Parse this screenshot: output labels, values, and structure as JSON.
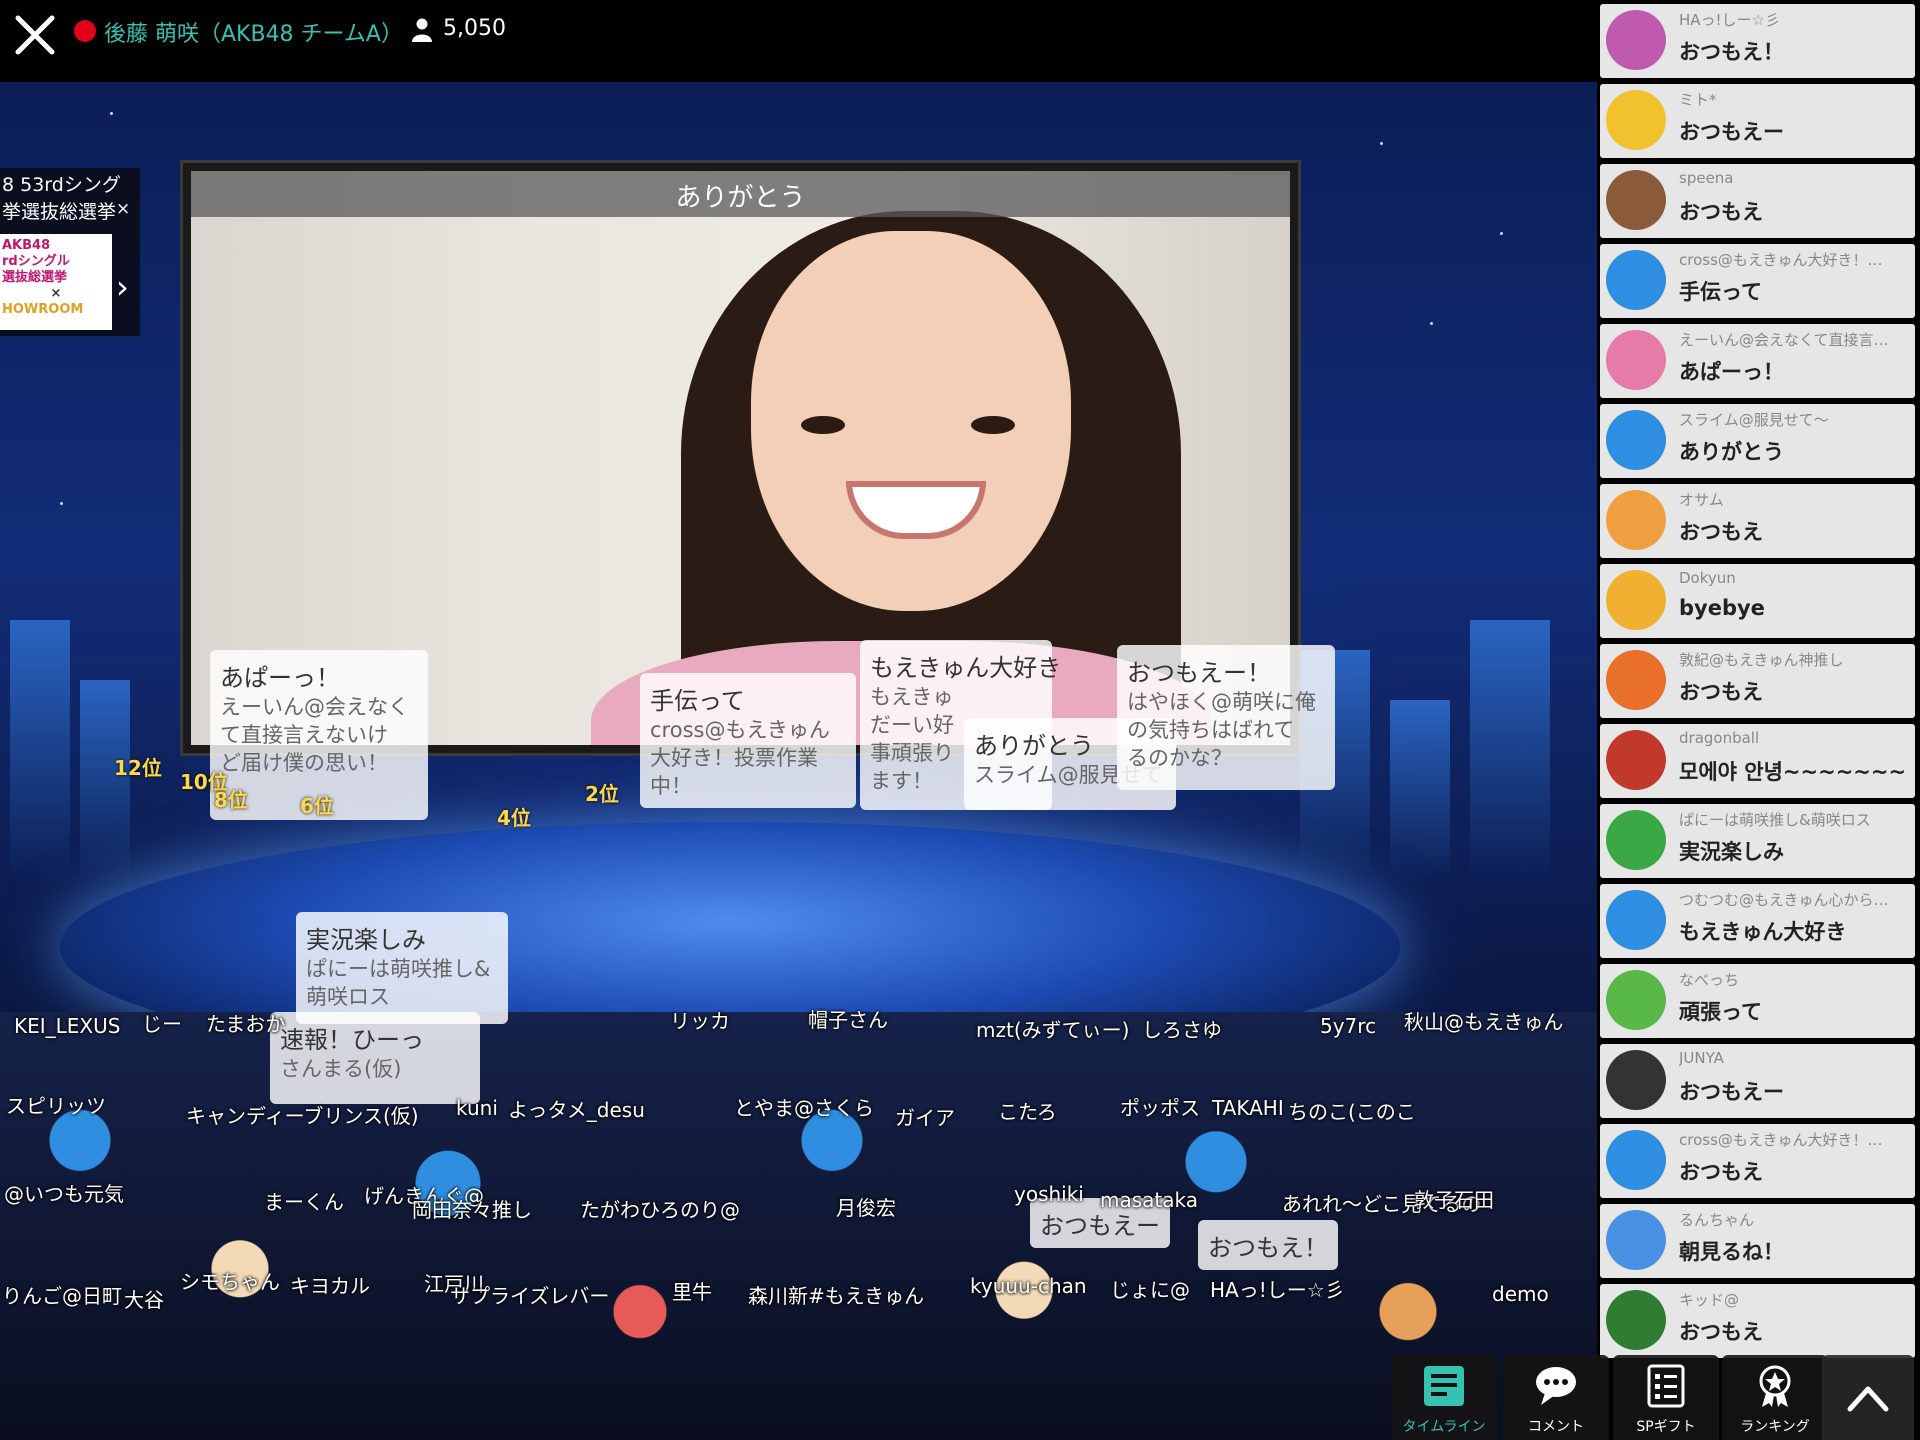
{
  "header": {
    "streamer": "後藤 萌咲（AKB48 チームA）",
    "viewers": "5,050"
  },
  "event": {
    "text_line1": "8 53rdシング",
    "text_line2": "挙選抜総選挙",
    "close": "×",
    "logo_line1": "AKB48",
    "logo_line2": "rdシングル",
    "logo_line3": "選抜総選挙",
    "logo_line4": "×",
    "logo_line5": "HOWROOM",
    "arrow": "›"
  },
  "video": {
    "title": "ありがとう"
  },
  "bubbles": [
    {
      "title": "あぱーっ！",
      "sub": "えーいん@会えなく\nて直接言えないけ\nど届け僕の思い！"
    },
    {
      "title": "手伝って",
      "sub": "cross@もえきゅん\n大好き！投票作業\n中！"
    },
    {
      "title": "もえきゅん大好き",
      "sub": "もえきゅ\nだーい好\n事頑張り\nます！"
    },
    {
      "title": "ありがとう",
      "sub": "スライム@服見せて"
    },
    {
      "title": "おつもえー！",
      "sub": "はやほく@萌咲に俺\nの気持ちはばれて\nるのかな？"
    },
    {
      "title": "実況楽しみ",
      "sub": "ぱにーは萌咲推し&\n萌咲ロス"
    },
    {
      "title": "速報！ひーっ",
      "sub": "さんまる(仮)"
    },
    {
      "title": "おつもえー",
      "sub": ""
    },
    {
      "title": "おつもえ！",
      "sub": ""
    }
  ],
  "crowd_names": [
    "KEI_LEXUS",
    "じー",
    "たまおか",
    "リッカ",
    "帽子さん",
    "mzt(みずてぃー)",
    "しろさゆ",
    "5y7rc",
    "秋山@もえきゅん",
    "スピリッツ",
    "キャンディーブリンス(仮)",
    "kuni",
    "よっタメ_desu",
    "とやま@さくら",
    "ガイア",
    "こたろ",
    "ポッポス",
    "TAKAHI",
    "ちのこ(このこ",
    "@いつも元気",
    "まーくん",
    "げんきんぐ@",
    "岡田奈々推し",
    "たがわひろのり@",
    "月俊宏",
    "yoshiki",
    "masataka",
    "あれれ〜どこ見てるの",
    "敦子石田",
    "りんご@日町",
    "大谷",
    "シモちゃん",
    "キヨカル",
    "江戸川",
    "サプライズレバー",
    "里牛",
    "森川新#もえきゅん",
    "kyuuu-chan",
    "じょに@",
    "HAっ!しー☆彡",
    "demo"
  ],
  "ranks": [
    "12位",
    "10位",
    "8位",
    "6位",
    "4位",
    "2位"
  ],
  "comments": [
    {
      "user": "HAっ!しー☆彡",
      "text": "おつもえ！",
      "avatar_color": "#c05ab0"
    },
    {
      "user": "ミト*",
      "text": "おつもえー",
      "avatar_color": "#f2c12e"
    },
    {
      "user": "speena",
      "text": "おつもえ",
      "avatar_color": "#8a5a3a"
    },
    {
      "user": "cross@もえきゅん大好き！…",
      "text": "手伝って",
      "avatar_color": "#2f8ee0"
    },
    {
      "user": "えーいん@会えなくて直接言…",
      "text": "あぱーっ！",
      "avatar_color": "#e67aa8"
    },
    {
      "user": "スライム@服見せて〜",
      "text": "ありがとう",
      "avatar_color": "#2f8ee0"
    },
    {
      "user": "オサム",
      "text": "おつもえ",
      "avatar_color": "#f0a040"
    },
    {
      "user": "Dokyun",
      "text": "byebye",
      "avatar_color": "#f0b030"
    },
    {
      "user": "敦紀@もえきゅん神推し",
      "text": "おつもえ",
      "avatar_color": "#e8702a"
    },
    {
      "user": "dragonball",
      "text": "모에야 안녕~~~~~~~",
      "avatar_color": "#c0392b"
    },
    {
      "user": "ぱにーは萌咲推し&萌咲ロス",
      "text": "実況楽しみ",
      "avatar_color": "#3aa845"
    },
    {
      "user": "つむつむ@もえきゅん心から…",
      "text": "もえきゅん大好き",
      "avatar_color": "#2f8ee0"
    },
    {
      "user": "なべっち",
      "text": "頑張って",
      "avatar_color": "#58b848"
    },
    {
      "user": "JUNYA",
      "text": "おつもえー",
      "avatar_color": "#333333"
    },
    {
      "user": "cross@もえきゅん大好き！…",
      "text": "おつもえ",
      "avatar_color": "#2f8ee0"
    },
    {
      "user": "るんちゃん",
      "text": "朝見るね！",
      "avatar_color": "#4a90e2"
    },
    {
      "user": "キッド@",
      "text": "おつもえ",
      "avatar_color": "#2e7d32"
    }
  ],
  "nav": {
    "timeline": "タイムライン",
    "comment": "コメント",
    "sp_gift": "SPギフト",
    "ranking": "ランキング"
  },
  "colors": {
    "accent": "#36c2b1",
    "live": "#e00019"
  }
}
